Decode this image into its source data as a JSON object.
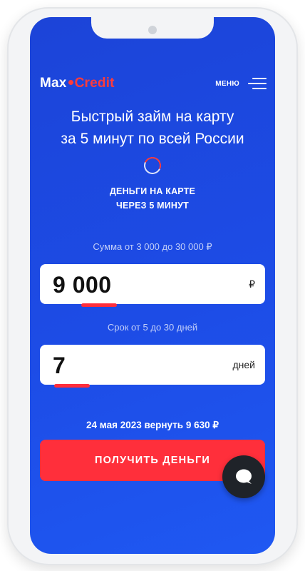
{
  "header": {
    "logo_left": "Max",
    "logo_right": "Credit",
    "menu_label": "МЕНЮ"
  },
  "hero": {
    "title_line1": "Быстрый займ на карту",
    "title_line2": "за 5 минут по всей России",
    "subtitle_line1": "ДЕНЬГИ НА КАРТЕ",
    "subtitle_line2": "ЧЕРЕЗ 5 МИНУТ"
  },
  "amount": {
    "range_label": "Сумма от 3 000 до 30 000 ₽",
    "value": "9 000",
    "unit": "₽"
  },
  "term": {
    "range_label": "Срок от 5 до 30 дней",
    "value": "7",
    "unit": "дней"
  },
  "result_text": "24 мая 2023 вернуть 9 630 ₽",
  "cta_label": "ПОЛУЧИТЬ ДЕНЬГИ",
  "icons": {
    "menu": "hamburger-icon",
    "loader": "spinner-icon",
    "chat": "chat-bubble-icon"
  },
  "colors": {
    "brand_blue": "#1d4ce6",
    "accent_red": "#ff2f3b"
  }
}
